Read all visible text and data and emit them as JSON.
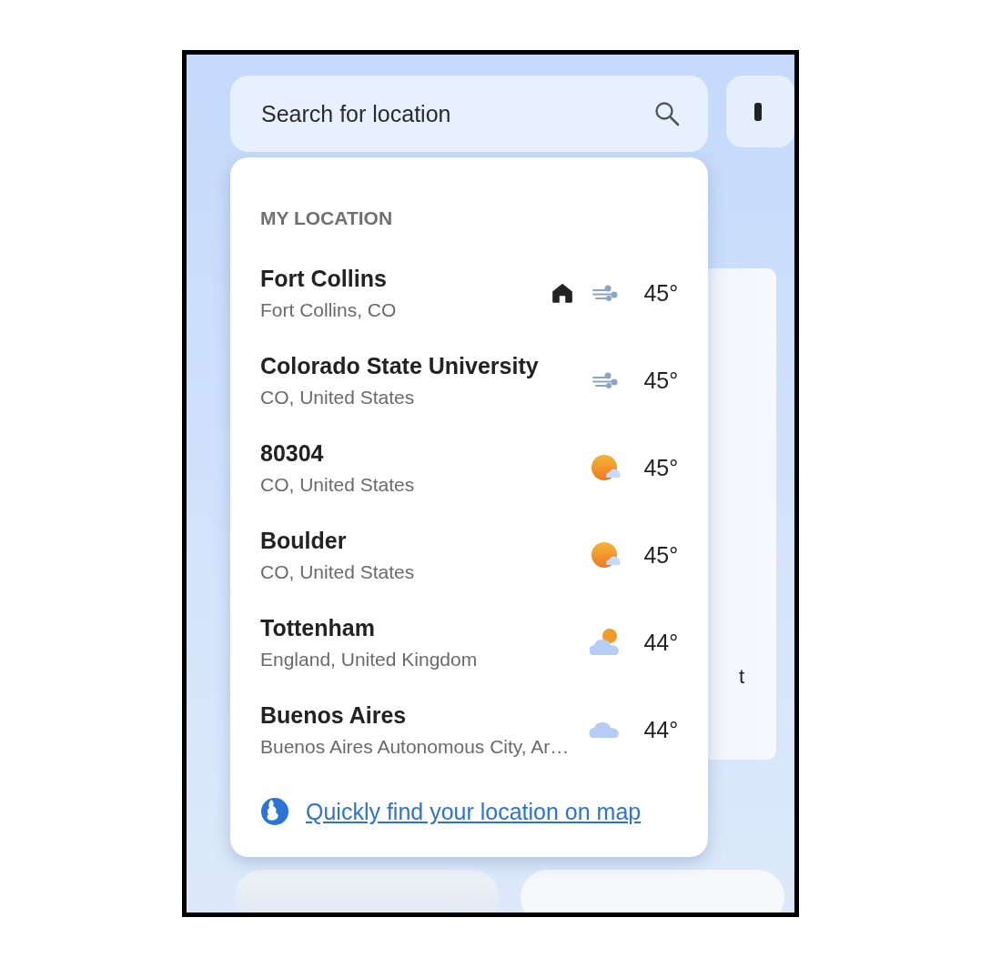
{
  "search": {
    "placeholder": "Search for location"
  },
  "dropdown": {
    "header": "MY LOCATION",
    "locations": [
      {
        "name": "Fort Collins",
        "region": "Fort Collins, CO",
        "home": true,
        "kind": "wind",
        "temp": "45°"
      },
      {
        "name": "Colorado State University",
        "region": "CO, United States",
        "home": false,
        "kind": "wind",
        "temp": "45°"
      },
      {
        "name": "80304",
        "region": "CO, United States",
        "home": false,
        "kind": "sun-cloud",
        "temp": "45°"
      },
      {
        "name": "Boulder",
        "region": "CO, United States",
        "home": false,
        "kind": "sun-cloud",
        "temp": "45°"
      },
      {
        "name": "Tottenham",
        "region": "England, United Kingdom",
        "home": false,
        "kind": "cloud-sun",
        "temp": "44°"
      },
      {
        "name": "Buenos Aires",
        "region": "Buenos Aires Autonomous City, Ar…",
        "home": false,
        "kind": "cloud",
        "temp": "44°"
      }
    ],
    "map_link": "Quickly find your location on map"
  },
  "background_card": {
    "text": "t"
  }
}
